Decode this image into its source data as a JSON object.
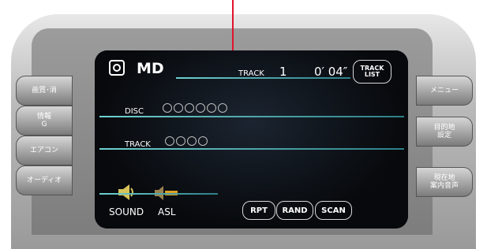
{
  "left_buttons": [
    "画質･消",
    "情報\nG",
    "エアコン",
    "オーディオ"
  ],
  "right_buttons": [
    "メニュー",
    "目的地\n設定",
    "現在地\n案内音声"
  ],
  "screen": {
    "source": "MD",
    "track_label": "TRACK",
    "track_number": "1",
    "time": "0′ 04″",
    "track_list_btn": "TRACK\nLIST",
    "disc_label": "DISC",
    "disc_circles": 6,
    "track_row_label": "TRACK",
    "track_circles": 4,
    "sound_label": "SOUND",
    "asl_label": "ASL",
    "rpt_label": "RPT",
    "rand_label": "RAND",
    "scan_label": "SCAN"
  },
  "colors": {
    "accent_line": "#6fd0d0",
    "arrow": "#e0142c",
    "speaker": "#d8c25a"
  }
}
